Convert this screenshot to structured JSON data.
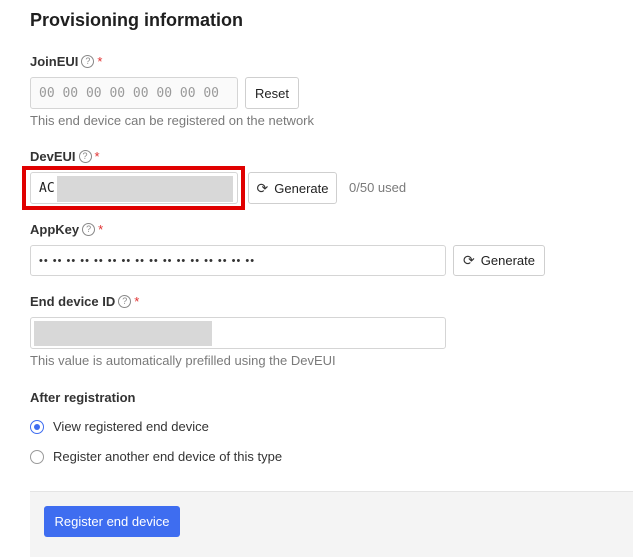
{
  "section": {
    "title": "Provisioning information"
  },
  "join_eui": {
    "label": "JoinEUI",
    "help": "?",
    "required": "*",
    "value": "00 00 00 00 00 00 00 00",
    "reset_label": "Reset",
    "hint": "This end device can be registered on the network"
  },
  "dev_eui": {
    "label": "DevEUI",
    "help": "?",
    "required": "*",
    "value": "AC",
    "generate_label": "Generate",
    "usage": "0/50 used"
  },
  "app_key": {
    "label": "AppKey",
    "help": "?",
    "required": "*",
    "value": "•• •• •• •• •• •• •• •• •• •• •• •• •• •• •• ••",
    "generate_label": "Generate"
  },
  "end_device_id": {
    "label": "End device ID",
    "help": "?",
    "required": "*",
    "hint": "This value is automatically prefilled using the DevEUI"
  },
  "after_registration": {
    "title": "After registration",
    "options": [
      {
        "label": "View registered end device",
        "checked": true
      },
      {
        "label": "Register another end device of this type",
        "checked": false
      }
    ]
  },
  "footer": {
    "submit_label": "Register end device"
  },
  "icons": {
    "refresh": "refresh-icon",
    "help": "help-circle-icon"
  },
  "colors": {
    "primary": "#3e6df0",
    "highlight": "#e00000",
    "required": "#e03131"
  }
}
